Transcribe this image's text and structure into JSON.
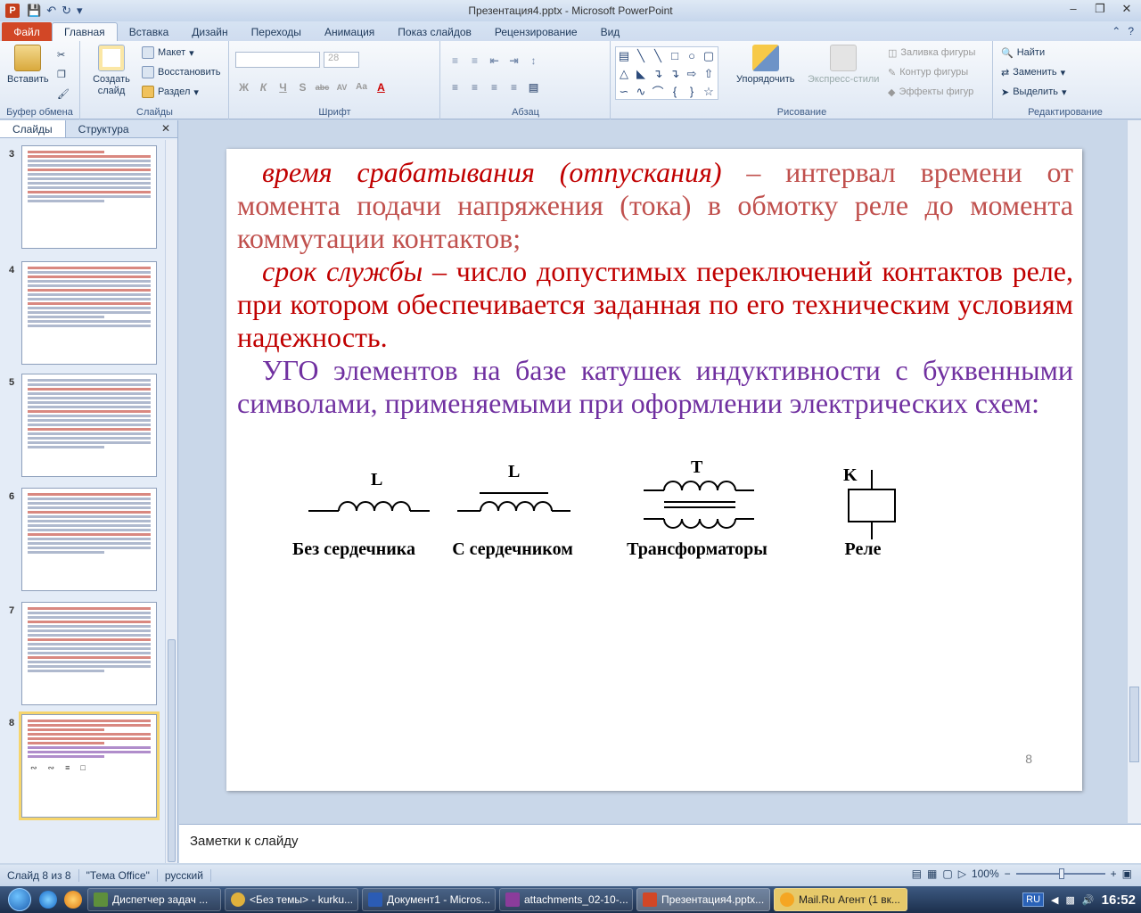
{
  "window": {
    "title": "Презентация4.pptx - Microsoft PowerPoint",
    "app_icon_letter": "P"
  },
  "tabs": {
    "file": "Файл",
    "items": [
      "Главная",
      "Вставка",
      "Дизайн",
      "Переходы",
      "Анимация",
      "Показ слайдов",
      "Рецензирование",
      "Вид"
    ],
    "active_index": 0
  },
  "ribbon": {
    "clipboard": {
      "paste": "Вставить",
      "label": "Буфер обмена"
    },
    "slides": {
      "new_slide": "Создать слайд",
      "layout": "Макет",
      "reset": "Восстановить",
      "section": "Раздел",
      "label": "Слайды"
    },
    "font": {
      "size": "28",
      "label": "Шрифт",
      "buttons": [
        "Ж",
        "К",
        "Ч",
        "S",
        "abc",
        "AV",
        "Aa",
        "A"
      ]
    },
    "paragraph": {
      "label": "Абзац"
    },
    "drawing": {
      "arrange": "Упорядочить",
      "quick_styles": "Экспресс-стили",
      "fill": "Заливка фигуры",
      "outline": "Контур фигуры",
      "effects": "Эффекты фигур",
      "label": "Рисование"
    },
    "editing": {
      "find": "Найти",
      "replace": "Заменить",
      "select": "Выделить",
      "label": "Редактирование"
    }
  },
  "left_pane": {
    "tabs": [
      "Слайды",
      "Структура"
    ],
    "slide_numbers": [
      "3",
      "4",
      "5",
      "6",
      "7",
      "8"
    ],
    "selected": "8"
  },
  "slide": {
    "p1_term": "время срабатывания (отпускания)",
    "p1_rest": " – интервал времени от момента подачи напряжения (тока) в обмотку реле до момента коммутации контактов;",
    "p2_term": "срок службы",
    "p2_rest": " – число допустимых переключений контактов реле, при котором обеспечивается заданная по его техническим условиям надежность.",
    "p3": "УГО элементов на базе катушек индуктивности с буквенными символами, применяемыми при оформлении электрических схем:",
    "symbols": [
      {
        "letter": "L",
        "caption": "Без сердечника"
      },
      {
        "letter": "L",
        "caption": "С сердечником"
      },
      {
        "letter": "T",
        "caption": "Трансформаторы"
      },
      {
        "letter": "K",
        "caption": "Реле"
      }
    ],
    "page_number": "8",
    "colors": {
      "term_red": "#c00000",
      "text_red": "#c0504d",
      "text_purple": "#7030a0"
    }
  },
  "notes": {
    "placeholder": "Заметки к слайду"
  },
  "status": {
    "slide_info": "Слайд 8 из 8",
    "theme": "\"Тема Office\"",
    "language": "русский",
    "zoom": "100%"
  },
  "taskbar": {
    "tasks": [
      "Диспетчер задач ...",
      "<Без темы> - kurku...",
      "Документ1 - Micros...",
      "attachments_02-10-...",
      "Презентация4.pptx...",
      "Mail.Ru Агент (1 вк..."
    ],
    "active_index": 4,
    "lang": "RU",
    "time": "16:52"
  }
}
